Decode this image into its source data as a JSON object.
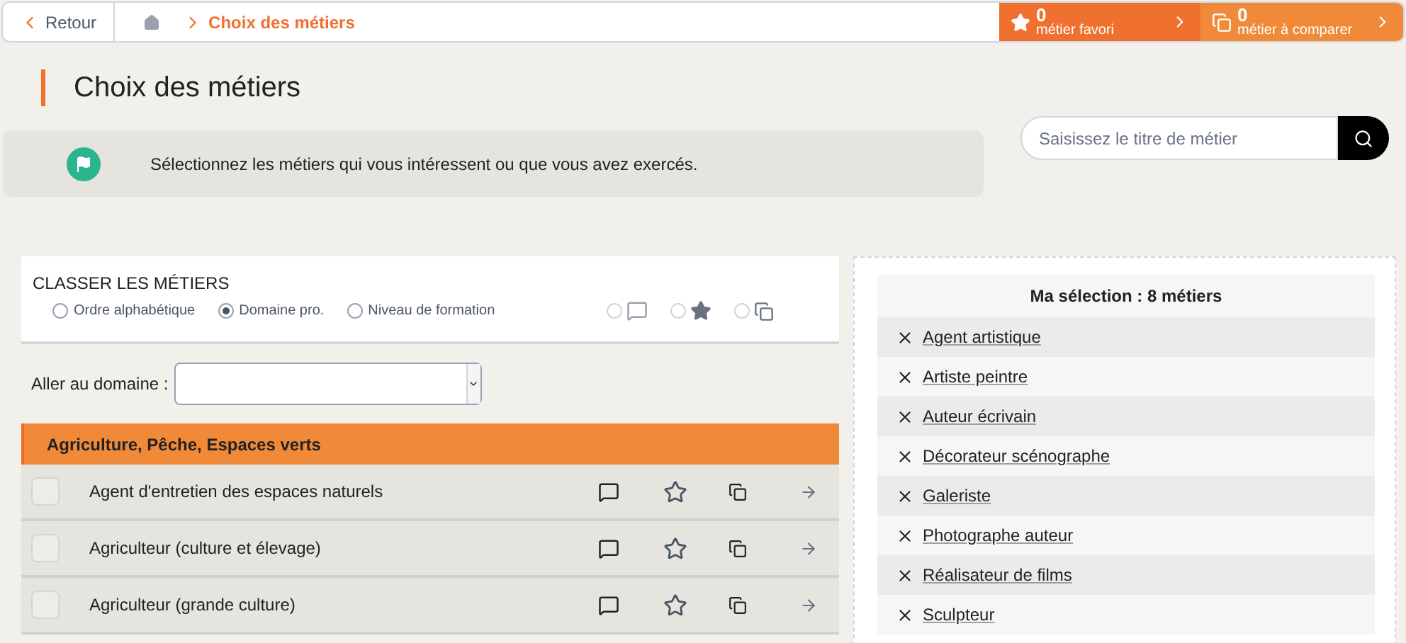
{
  "topbar": {
    "back": "Retour",
    "breadcrumb": "Choix des métiers",
    "favorites": {
      "count": "0",
      "label": "métier favori"
    },
    "compare": {
      "count": "0",
      "label": "métier à comparer"
    }
  },
  "title": "Choix des métiers",
  "info": "Sélectionnez les métiers qui vous intéressent ou que vous avez exercés.",
  "search": {
    "placeholder": "Saisissez le titre de métier"
  },
  "sort": {
    "heading": "CLASSER LES MÉTIERS",
    "options": [
      {
        "label": "Ordre alphabétique",
        "selected": false
      },
      {
        "label": "Domaine pro.",
        "selected": true
      },
      {
        "label": "Niveau de formation",
        "selected": false
      }
    ],
    "filters": [
      {
        "kind": "comment",
        "selected": false
      },
      {
        "kind": "star",
        "selected": false
      },
      {
        "kind": "copy",
        "selected": false
      }
    ]
  },
  "domain_select": {
    "label": "Aller au domaine :"
  },
  "group": {
    "title": "Agriculture, Pêche, Espaces verts",
    "rows": [
      {
        "name": "Agent d'entretien des espaces naturels",
        "checked": false
      },
      {
        "name": "Agriculteur (culture et élevage)",
        "checked": false
      },
      {
        "name": "Agriculteur (grande culture)",
        "checked": false
      }
    ]
  },
  "selection": {
    "title": "Ma sélection : 8 métiers",
    "items": [
      "Agent artistique",
      "Artiste peintre",
      "Auteur écrivain",
      "Décorateur scénographe",
      "Galeriste",
      "Photographe auteur",
      "Réalisateur de films",
      "Sculpteur"
    ]
  }
}
